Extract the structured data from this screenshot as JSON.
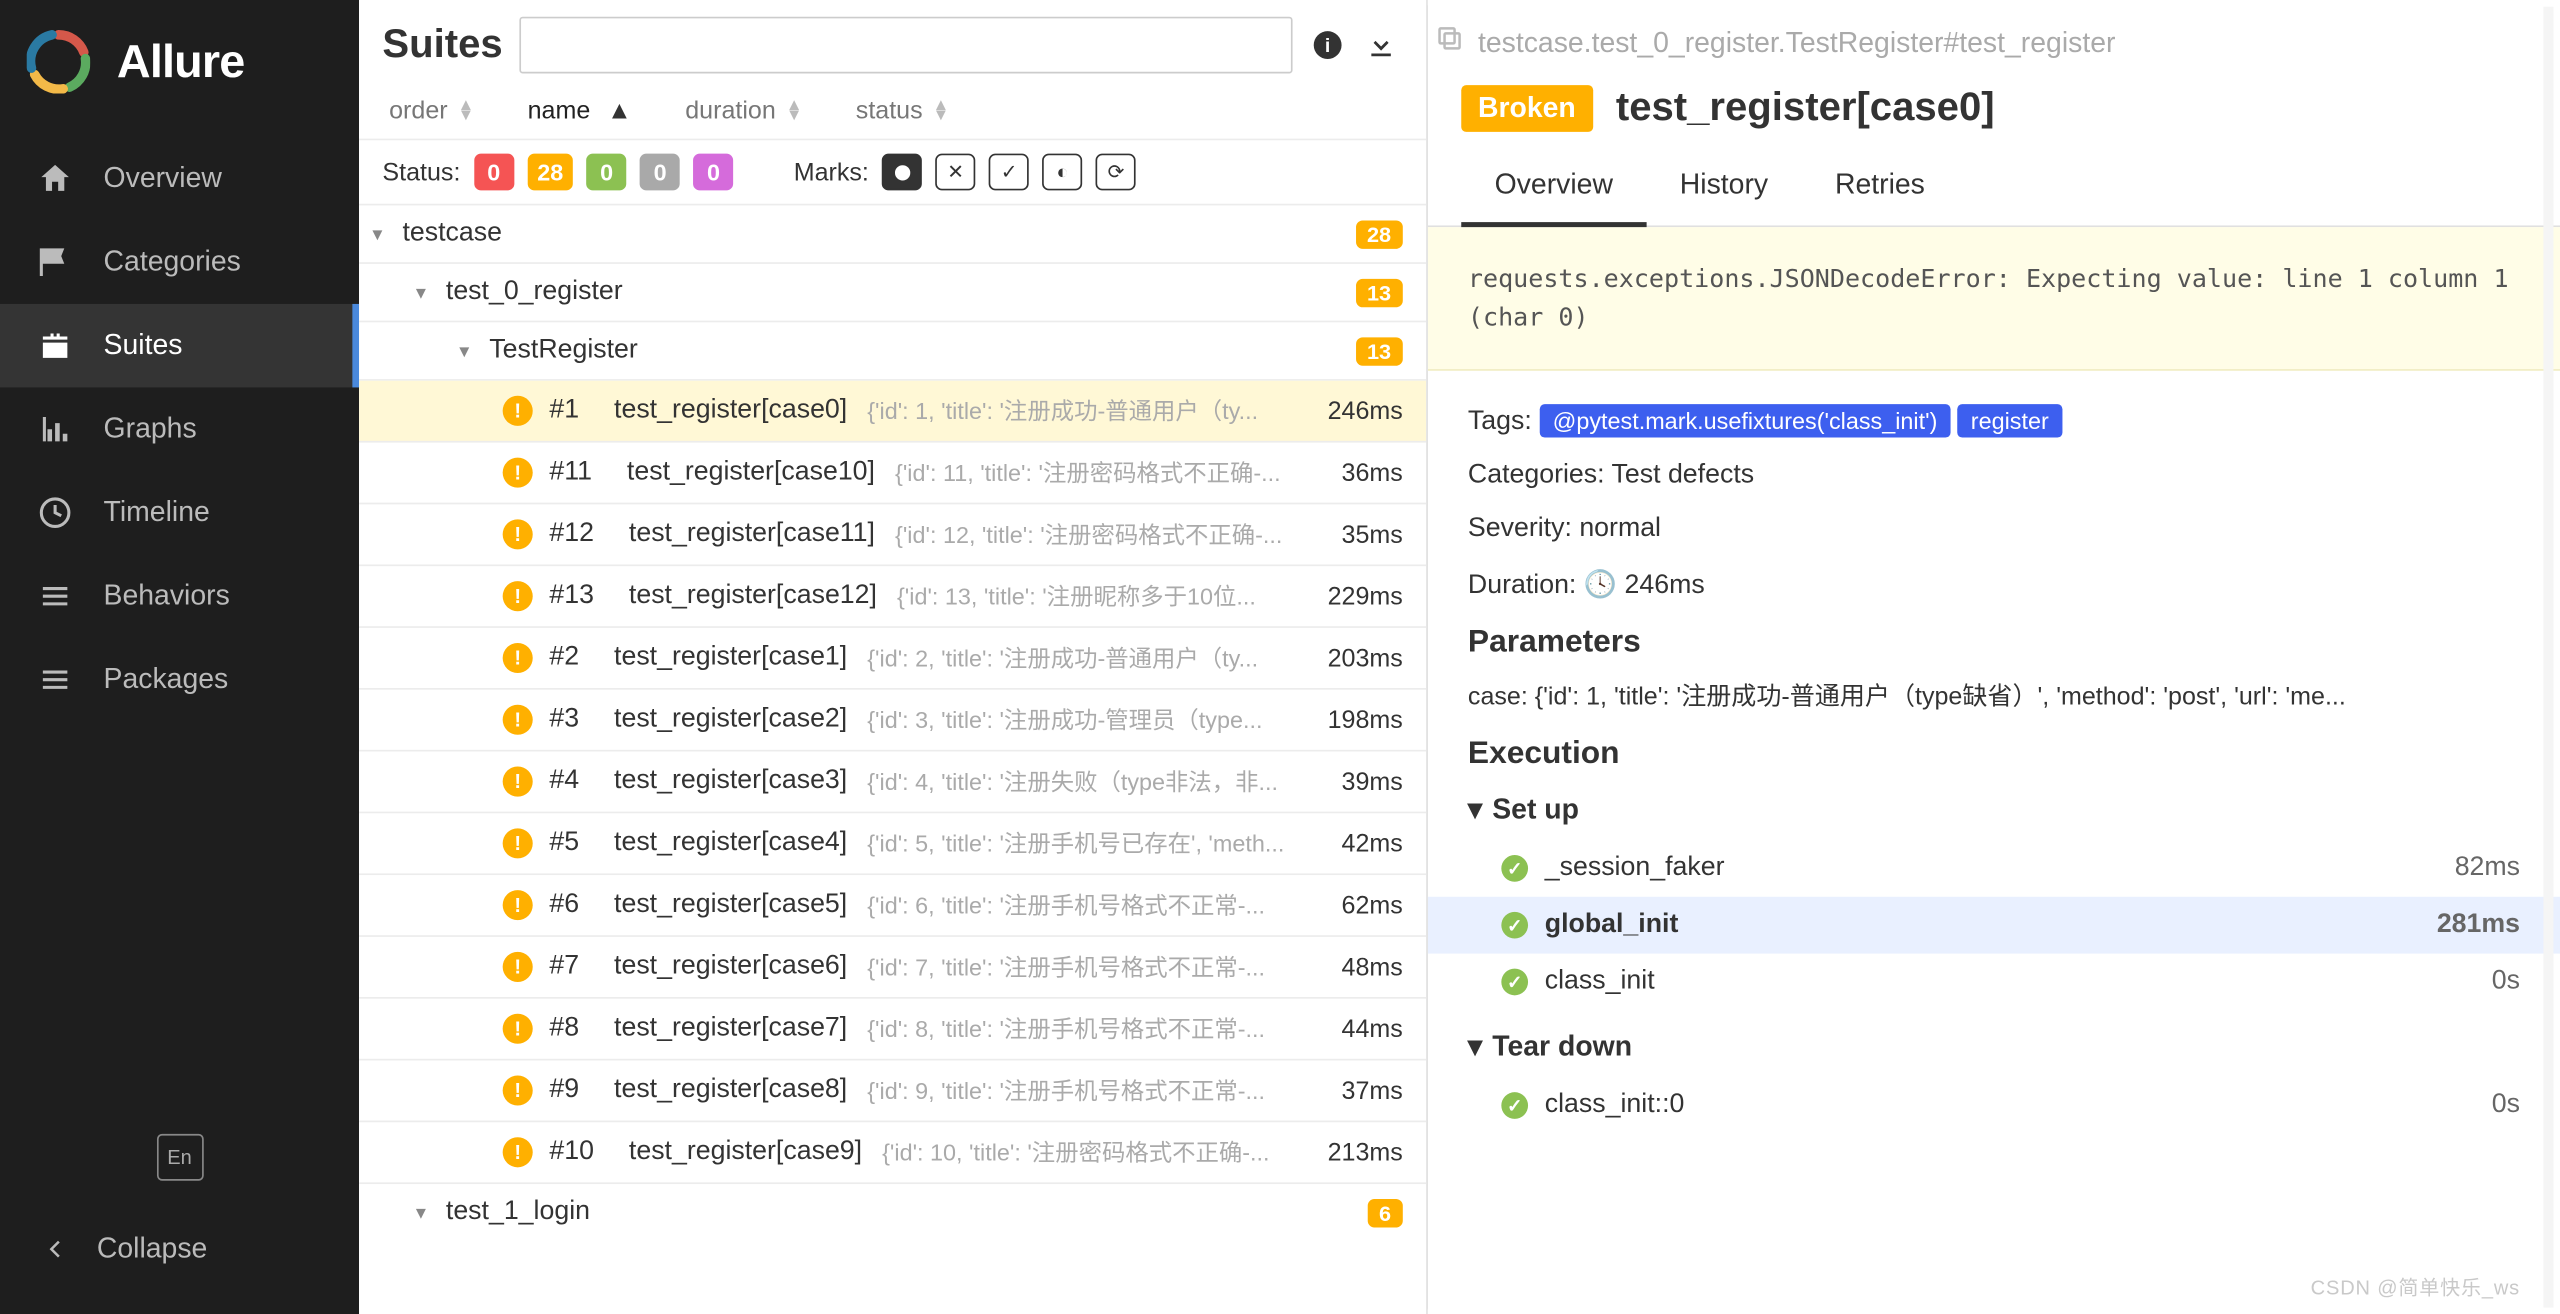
{
  "app": {
    "brand": "Allure"
  },
  "sidebar": {
    "items": [
      {
        "label": "Overview"
      },
      {
        "label": "Categories"
      },
      {
        "label": "Suites"
      },
      {
        "label": "Graphs"
      },
      {
        "label": "Timeline"
      },
      {
        "label": "Behaviors"
      },
      {
        "label": "Packages"
      }
    ],
    "lang": "En",
    "collapse": "Collapse"
  },
  "suites": {
    "title": "Suites",
    "search_placeholder": "",
    "sort": {
      "order": "order",
      "name": "name",
      "duration": "duration",
      "status": "status"
    },
    "statusLabel": "Status:",
    "marksLabel": "Marks:",
    "statusCounts": {
      "failed": 0,
      "broken": 28,
      "passed": 0,
      "skipped": 0,
      "unknown": 0
    },
    "tree": {
      "root": {
        "label": "testcase",
        "count": 28
      },
      "suite": {
        "label": "test_0_register",
        "count": 13
      },
      "cls": {
        "label": "TestRegister",
        "count": 13
      },
      "lastSuite": {
        "label": "test_1_login",
        "count": 6
      },
      "tests": [
        {
          "num": "#1",
          "name": "test_register[case0]",
          "meta": "{'id': 1, 'title': '注册成功-普通用户（ty...",
          "dur": "246ms",
          "selected": true
        },
        {
          "num": "#11",
          "name": "test_register[case10]",
          "meta": "{'id': 11, 'title': '注册密码格式不正确-...",
          "dur": "36ms"
        },
        {
          "num": "#12",
          "name": "test_register[case11]",
          "meta": "{'id': 12, 'title': '注册密码格式不正确-...",
          "dur": "35ms"
        },
        {
          "num": "#13",
          "name": "test_register[case12]",
          "meta": "{'id': 13, 'title': '注册昵称多于10位...",
          "dur": "229ms"
        },
        {
          "num": "#2",
          "name": "test_register[case1]",
          "meta": "{'id': 2, 'title': '注册成功-普通用户（ty...",
          "dur": "203ms"
        },
        {
          "num": "#3",
          "name": "test_register[case2]",
          "meta": "{'id': 3, 'title': '注册成功-管理员（type...",
          "dur": "198ms"
        },
        {
          "num": "#4",
          "name": "test_register[case3]",
          "meta": "{'id': 4, 'title': '注册失败（type非法，非...",
          "dur": "39ms"
        },
        {
          "num": "#5",
          "name": "test_register[case4]",
          "meta": "{'id': 5, 'title': '注册手机号已存在', 'meth...",
          "dur": "42ms"
        },
        {
          "num": "#6",
          "name": "test_register[case5]",
          "meta": "{'id': 6, 'title': '注册手机号格式不正常-...",
          "dur": "62ms"
        },
        {
          "num": "#7",
          "name": "test_register[case6]",
          "meta": "{'id': 7, 'title': '注册手机号格式不正常-...",
          "dur": "48ms"
        },
        {
          "num": "#8",
          "name": "test_register[case7]",
          "meta": "{'id': 8, 'title': '注册手机号格式不正常-...",
          "dur": "44ms"
        },
        {
          "num": "#9",
          "name": "test_register[case8]",
          "meta": "{'id': 9, 'title': '注册手机号格式不正常-...",
          "dur": "37ms"
        },
        {
          "num": "#10",
          "name": "test_register[case9]",
          "meta": "{'id': 10, 'title': '注册密码格式不正确-...",
          "dur": "213ms"
        }
      ]
    }
  },
  "detail": {
    "breadcrumb": "testcase.test_0_register.TestRegister#test_register",
    "statusBadge": "Broken",
    "title": "test_register[case0]",
    "tabs": {
      "overview": "Overview",
      "history": "History",
      "retries": "Retries"
    },
    "error": "requests.exceptions.JSONDecodeError: Expecting value: line 1 column 1 (char 0)",
    "tagsLabel": "Tags:",
    "tags": [
      "@pytest.mark.usefixtures('class_init')",
      "register"
    ],
    "categoriesLabel": "Categories:",
    "categories": "Test defects",
    "severityLabel": "Severity:",
    "severity": "normal",
    "durationLabel": "Duration:",
    "duration": "246ms",
    "parametersHdr": "Parameters",
    "paramLine": "case: {'id': 1, 'title': '注册成功-普通用户（type缺省）', 'method': 'post', 'url': 'me...",
    "executionHdr": "Execution",
    "setupHdr": "Set up",
    "setupItems": [
      {
        "name": "_session_faker",
        "dur": "82ms"
      },
      {
        "name": "global_init",
        "dur": "281ms",
        "selected": true
      },
      {
        "name": "class_init",
        "dur": "0s"
      }
    ],
    "teardownHdr": "Tear down",
    "teardownItems": [
      {
        "name": "class_init::0",
        "dur": "0s"
      }
    ]
  },
  "watermark": "CSDN @简单快乐_ws"
}
